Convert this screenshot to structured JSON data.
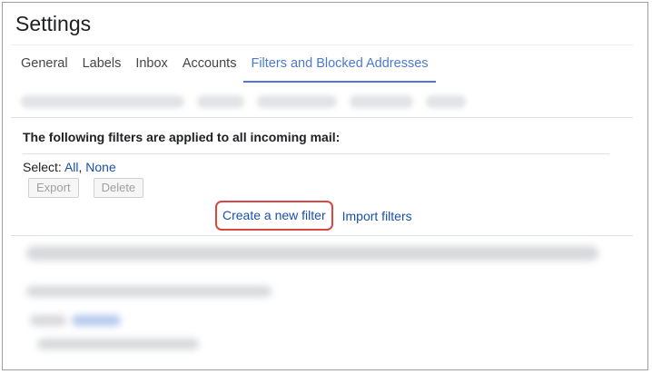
{
  "page": {
    "title": "Settings"
  },
  "tabs": [
    {
      "label": "General"
    },
    {
      "label": "Labels"
    },
    {
      "label": "Inbox"
    },
    {
      "label": "Accounts"
    },
    {
      "label": "Filters and Blocked Addresses"
    }
  ],
  "active_tab": "Filters and Blocked Addresses",
  "filters": {
    "heading": "The following filters are applied to all incoming mail:",
    "select_label": "Select:",
    "select_all": "All",
    "select_separator": ",",
    "select_none": "None",
    "export_label": "Export",
    "delete_label": "Delete",
    "create_filter_label": "Create a new filter",
    "import_filters_label": "Import filters"
  },
  "colors": {
    "accent": "#4d79d4",
    "link": "#1a4fae",
    "highlight_border": "#d9473f"
  }
}
